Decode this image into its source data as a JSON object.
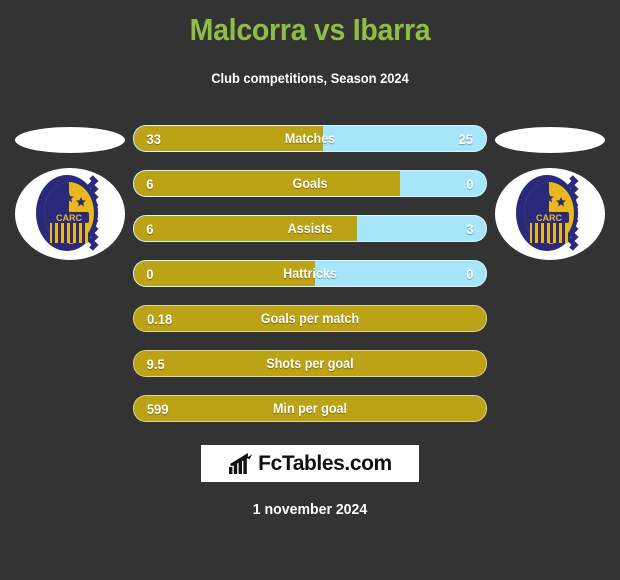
{
  "header": {
    "title": "Malcorra vs Ibarra",
    "subtitle": "Club competitions, Season 2024",
    "title_color": "#8DBF45"
  },
  "teams": {
    "home": {
      "crest_name": "carc-rosario-central-crest",
      "crest_text": "CARC"
    },
    "away": {
      "crest_name": "carc-rosario-central-crest",
      "crest_text": "CARC"
    }
  },
  "colors": {
    "background": "#333333",
    "home_bar": "#BCA316",
    "away_bar": "#A6E6FA",
    "accent_green": "#8DBF45",
    "text": "#FFFFFF"
  },
  "stats": [
    {
      "label": "Matches",
      "home": "33",
      "away": "25",
      "home_pct": 53.7,
      "dual": true
    },
    {
      "label": "Goals",
      "home": "6",
      "away": "0",
      "home_pct": 75.7,
      "dual": true
    },
    {
      "label": "Assists",
      "home": "6",
      "away": "3",
      "home_pct": 63.3,
      "dual": true
    },
    {
      "label": "Hattricks",
      "home": "0",
      "away": "0",
      "home_pct": 51.4,
      "dual": true
    },
    {
      "label": "Goals per match",
      "home": "0.18",
      "away": "",
      "home_pct": 100,
      "dual": false
    },
    {
      "label": "Shots per goal",
      "home": "9.5",
      "away": "",
      "home_pct": 100,
      "dual": false
    },
    {
      "label": "Min per goal",
      "home": "599",
      "away": "",
      "home_pct": 100,
      "dual": false
    }
  ],
  "footer": {
    "brand_text": "FcTables.com",
    "brand_icon": "bar-chart-arrow-icon",
    "date": "1 november 2024"
  }
}
